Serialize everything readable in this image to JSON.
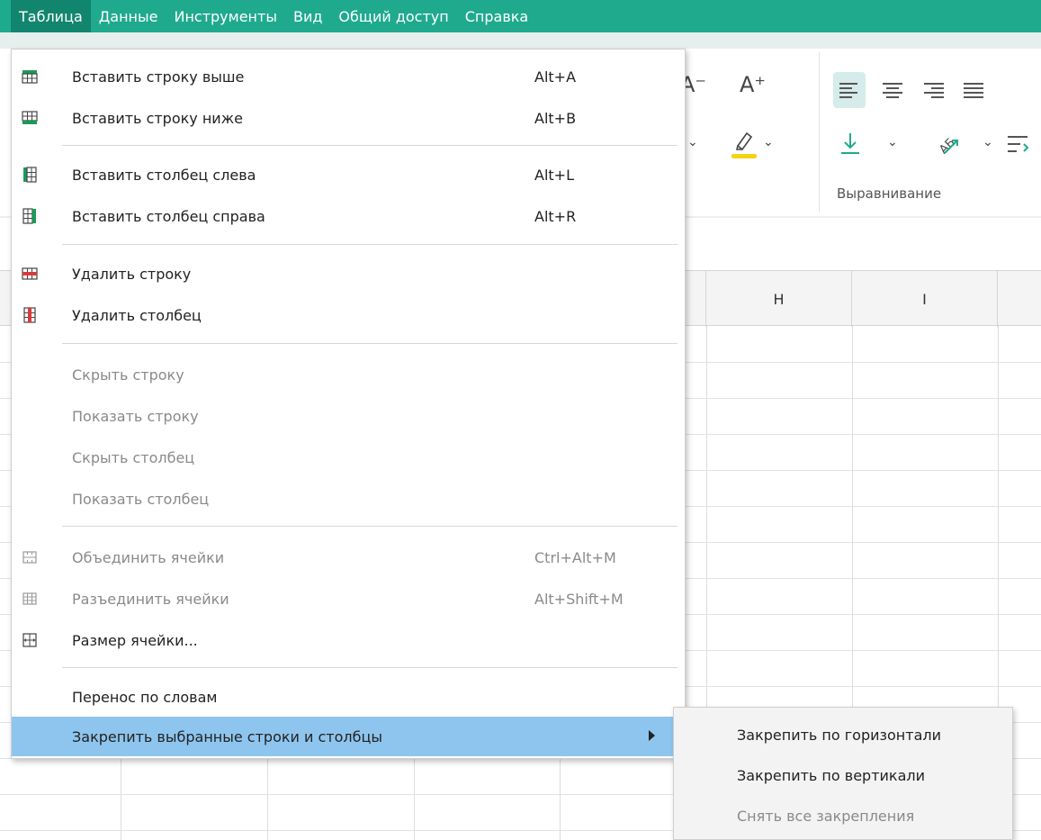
{
  "menubar": {
    "items": [
      {
        "label": "Таблица"
      },
      {
        "label": "Данные"
      },
      {
        "label": "Инструменты"
      },
      {
        "label": "Вид"
      },
      {
        "label": "Общий доступ"
      },
      {
        "label": "Справка"
      }
    ]
  },
  "ribbon": {
    "font_decrease": "A⁻",
    "font_increase": "A⁺",
    "alignment_group_label": "Выравнивание"
  },
  "sheet": {
    "column_headers": [
      "H",
      "I"
    ]
  },
  "dropdown": {
    "items": [
      {
        "label": "Вставить строку выше",
        "shortcut": "Alt+A"
      },
      {
        "label": "Вставить строку ниже",
        "shortcut": "Alt+B"
      },
      {
        "label": "Вставить столбец слева",
        "shortcut": "Alt+L"
      },
      {
        "label": "Вставить столбец справа",
        "shortcut": "Alt+R"
      },
      {
        "label": "Удалить строку",
        "shortcut": ""
      },
      {
        "label": "Удалить столбец",
        "shortcut": ""
      },
      {
        "label": "Скрыть строку",
        "shortcut": ""
      },
      {
        "label": "Показать строку",
        "shortcut": ""
      },
      {
        "label": "Скрыть столбец",
        "shortcut": ""
      },
      {
        "label": "Показать столбец",
        "shortcut": ""
      },
      {
        "label": "Объединить ячейки",
        "shortcut": "Ctrl+Alt+M"
      },
      {
        "label": "Разъединить ячейки",
        "shortcut": "Alt+Shift+M"
      },
      {
        "label": "Размер ячейки...",
        "shortcut": ""
      },
      {
        "label": "Перенос по словам",
        "shortcut": ""
      },
      {
        "label": "Закрепить выбранные строки и столбцы",
        "shortcut": ""
      }
    ]
  },
  "submenu": {
    "items": [
      {
        "label": "Закрепить по горизонтали"
      },
      {
        "label": "Закрепить по вертикали"
      },
      {
        "label": "Снять все закрепления"
      }
    ]
  },
  "colors": {
    "menubar": "#1faa8e",
    "menubar_active": "#12856e",
    "hover": "#8ec5ee",
    "icon_green": "#1a9b57",
    "icon_red": "#d93a3a",
    "highlight_yellow": "#f5d313"
  },
  "icons": {
    "insert_row_above": "insert-row-above-icon",
    "insert_row_below": "insert-row-below-icon",
    "insert_col_left": "insert-column-left-icon",
    "insert_col_right": "insert-column-right-icon",
    "delete_row": "delete-row-icon",
    "delete_col": "delete-column-icon",
    "merge": "merge-cells-icon",
    "unmerge": "unmerge-cells-icon",
    "cell_size": "cell-size-icon",
    "submenu_arrow": "submenu-arrow-icon"
  }
}
